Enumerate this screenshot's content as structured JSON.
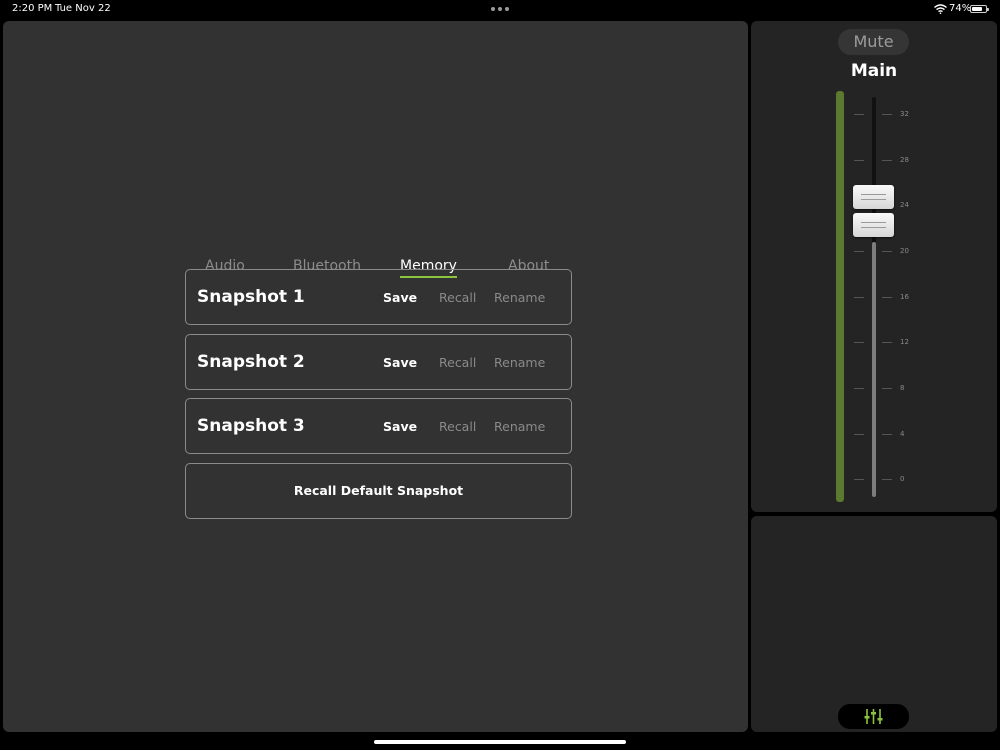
{
  "status_bar": {
    "time": "2:20 PM",
    "date": "Tue Nov 22",
    "battery": "74%"
  },
  "tabs": [
    {
      "label": "Audio",
      "active": false
    },
    {
      "label": "Bluetooth",
      "active": false
    },
    {
      "label": "Memory",
      "active": true
    },
    {
      "label": "About",
      "active": false
    }
  ],
  "snapshots": [
    {
      "name": "Snapshot 1",
      "save": "Save",
      "recall": "Recall",
      "rename": "Rename"
    },
    {
      "name": "Snapshot 2",
      "save": "Save",
      "recall": "Recall",
      "rename": "Rename"
    },
    {
      "name": "Snapshot 3",
      "save": "Save",
      "recall": "Recall",
      "rename": "Rename"
    }
  ],
  "recall_default": "Recall Default Snapshot",
  "channel": {
    "mute_label": "Mute",
    "name": "Main",
    "scale_labels": [
      "32",
      "28",
      "24",
      "20",
      "16",
      "12",
      "8",
      "4",
      "0"
    ]
  },
  "colors": {
    "accent": "#8cc43f",
    "meter": "#5b7a2f",
    "panel": "#323232"
  },
  "icons": {
    "mixer": "mixer-sliders-icon"
  }
}
